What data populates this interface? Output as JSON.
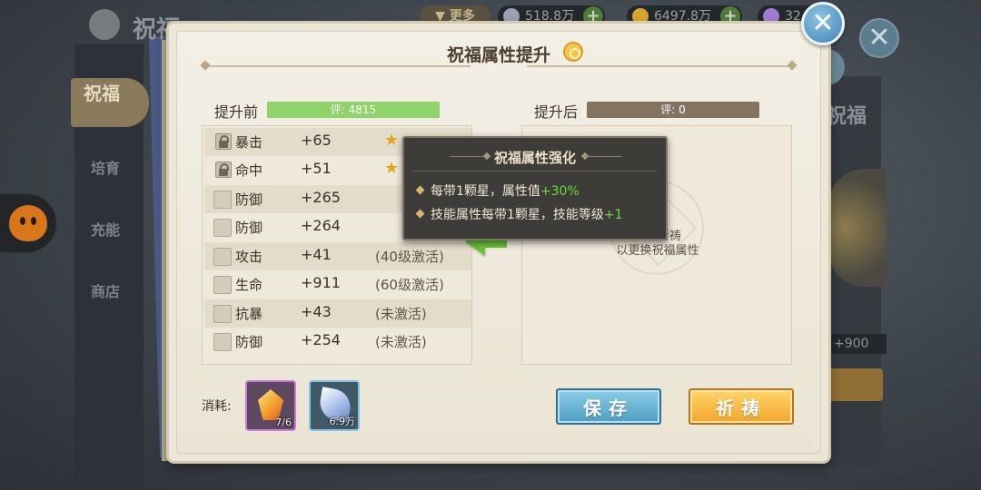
{
  "background": {
    "title": "祝福",
    "more_label": "更多",
    "resources": [
      {
        "name": "silver",
        "value": "518.8万",
        "color": "#9aa0b5"
      },
      {
        "name": "gold",
        "value": "6497.8万",
        "color": "#d6a52c"
      },
      {
        "name": "gem",
        "value": "32",
        "color": "#a07bd6"
      }
    ],
    "nav": {
      "active": "祝福",
      "items": [
        "培育",
        "充能",
        "商店"
      ]
    },
    "right_title": "祝福",
    "right_value": "+900"
  },
  "dialog": {
    "title": "祝福属性提升",
    "before": {
      "label": "提升前",
      "score_text": "评: 4815",
      "score_fill": 1.0
    },
    "after": {
      "label": "提升后",
      "score_text": "评: 0",
      "hint_line1": "点击祈祷",
      "hint_line2": "以更换祝福属性"
    },
    "attributes": [
      {
        "name": "暴击",
        "value": "+65",
        "note": "",
        "locked": true,
        "star": true
      },
      {
        "name": "命中",
        "value": "+51",
        "note": "",
        "locked": true,
        "star": true
      },
      {
        "name": "防御",
        "value": "+265",
        "note": "",
        "locked": false,
        "star": false
      },
      {
        "name": "防御",
        "value": "+264",
        "note": "",
        "locked": false,
        "star": false
      },
      {
        "name": "攻击",
        "value": "+41",
        "note": "(40级激活)",
        "locked": false,
        "star": false
      },
      {
        "name": "生命",
        "value": "+911",
        "note": "(60级激活)",
        "locked": false,
        "star": false
      },
      {
        "name": "抗暴",
        "value": "+43",
        "note": "(未激活)",
        "locked": false,
        "star": false
      },
      {
        "name": "防御",
        "value": "+254",
        "note": "(未激活)",
        "locked": false,
        "star": false
      }
    ],
    "tooltip": {
      "title": "祝福属性强化",
      "line1_prefix": "每带1颗星，属性值",
      "line1_value": "+30%",
      "line2_prefix": "技能属性每带1颗星，技能等级",
      "line2_value": "+1"
    },
    "cost": {
      "label": "消耗:",
      "items": [
        {
          "name": "crystal-item",
          "count": "7/6"
        },
        {
          "name": "leaf-item",
          "count": "6.9万"
        }
      ]
    },
    "save_label": "保存",
    "pray_label": "祈祷",
    "close_symbol": "✕"
  }
}
